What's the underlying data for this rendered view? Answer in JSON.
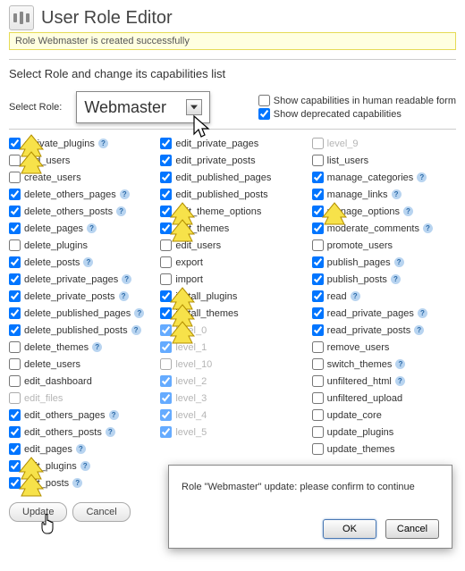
{
  "header": {
    "title": "User Role Editor"
  },
  "notice": "Role Webmaster is created successfully",
  "section_title": "Select Role and change its capabilities list",
  "select_role_label": "Select Role:",
  "role_select_value": "Webmaster",
  "options": {
    "show_human": {
      "label": "Show capabilities in human readable form",
      "checked": false
    },
    "show_deprecated": {
      "label": "Show deprecated capabilities",
      "checked": true
    }
  },
  "columns": [
    [
      {
        "name": "activate_plugins",
        "checked": true,
        "help": true
      },
      {
        "name": "add_users",
        "checked": false
      },
      {
        "name": "create_users",
        "checked": false
      },
      {
        "name": "delete_others_pages",
        "checked": true,
        "help": true
      },
      {
        "name": "delete_others_posts",
        "checked": true,
        "help": true
      },
      {
        "name": "delete_pages",
        "checked": true,
        "help": true
      },
      {
        "name": "delete_plugins",
        "checked": false
      },
      {
        "name": "delete_posts",
        "checked": true,
        "help": true
      },
      {
        "name": "delete_private_pages",
        "checked": true,
        "help": true
      },
      {
        "name": "delete_private_posts",
        "checked": true,
        "help": true
      },
      {
        "name": "delete_published_pages",
        "checked": true,
        "help": true
      },
      {
        "name": "delete_published_posts",
        "checked": true,
        "help": true
      },
      {
        "name": "delete_themes",
        "checked": false,
        "help": true
      },
      {
        "name": "delete_users",
        "checked": false
      },
      {
        "name": "edit_dashboard",
        "checked": false
      },
      {
        "name": "edit_files",
        "checked": false,
        "disabled": true
      },
      {
        "name": "edit_others_pages",
        "checked": true,
        "help": true
      },
      {
        "name": "edit_others_posts",
        "checked": true,
        "help": true
      },
      {
        "name": "edit_pages",
        "checked": true,
        "help": true
      },
      {
        "name": "edit_plugins",
        "checked": true,
        "help": true
      },
      {
        "name": "edit_posts",
        "checked": true,
        "help": true
      }
    ],
    [
      {
        "name": "edit_private_pages",
        "checked": true
      },
      {
        "name": "edit_private_posts",
        "checked": true
      },
      {
        "name": "edit_published_pages",
        "checked": true
      },
      {
        "name": "edit_published_posts",
        "checked": true
      },
      {
        "name": "edit_theme_options",
        "checked": true
      },
      {
        "name": "edit_themes",
        "checked": true
      },
      {
        "name": "edit_users",
        "checked": false
      },
      {
        "name": "export",
        "checked": false
      },
      {
        "name": "import",
        "checked": false
      },
      {
        "name": "install_plugins",
        "checked": true
      },
      {
        "name": "install_themes",
        "checked": true
      },
      {
        "name": "level_0",
        "checked": true,
        "disabled": true
      },
      {
        "name": "level_1",
        "checked": true,
        "disabled": true
      },
      {
        "name": "level_10",
        "checked": false,
        "disabled": true
      },
      {
        "name": "level_2",
        "checked": true,
        "disabled": true
      },
      {
        "name": "level_3",
        "checked": true,
        "disabled": true
      },
      {
        "name": "level_4",
        "checked": true,
        "disabled": true
      },
      {
        "name": "level_5",
        "checked": true,
        "disabled": true
      }
    ],
    [
      {
        "name": "level_9",
        "checked": false,
        "disabled": true
      },
      {
        "name": "list_users",
        "checked": false
      },
      {
        "name": "manage_categories",
        "checked": true,
        "help": true
      },
      {
        "name": "manage_links",
        "checked": true,
        "help": true
      },
      {
        "name": "manage_options",
        "checked": true,
        "help": true
      },
      {
        "name": "moderate_comments",
        "checked": true,
        "help": true
      },
      {
        "name": "promote_users",
        "checked": false
      },
      {
        "name": "publish_pages",
        "checked": true,
        "help": true
      },
      {
        "name": "publish_posts",
        "checked": true,
        "help": true
      },
      {
        "name": "read",
        "checked": true,
        "help": true
      },
      {
        "name": "read_private_pages",
        "checked": true,
        "help": true
      },
      {
        "name": "read_private_posts",
        "checked": true,
        "help": true
      },
      {
        "name": "remove_users",
        "checked": false
      },
      {
        "name": "switch_themes",
        "checked": false,
        "help": true
      },
      {
        "name": "unfiltered_html",
        "checked": false,
        "help": true
      },
      {
        "name": "unfiltered_upload",
        "checked": false
      },
      {
        "name": "update_core",
        "checked": false
      },
      {
        "name": "update_plugins",
        "checked": false
      },
      {
        "name": "update_themes",
        "checked": false
      }
    ]
  ],
  "buttons": {
    "update": "Update",
    "cancel": "Cancel"
  },
  "dialog": {
    "message": "Role \"Webmaster\" update: please confirm to continue",
    "ok": "OK",
    "cancel": "Cancel"
  },
  "markers": [
    {
      "col": 0,
      "row": 0
    },
    {
      "col": 0,
      "row": 1
    },
    {
      "col": 0,
      "row": 19
    },
    {
      "col": 0,
      "row": 20
    },
    {
      "col": 1,
      "row": 4
    },
    {
      "col": 1,
      "row": 5
    },
    {
      "col": 1,
      "row": 9
    },
    {
      "col": 1,
      "row": 10
    },
    {
      "col": 1,
      "row": 11
    },
    {
      "col": 2,
      "row": 4
    }
  ]
}
